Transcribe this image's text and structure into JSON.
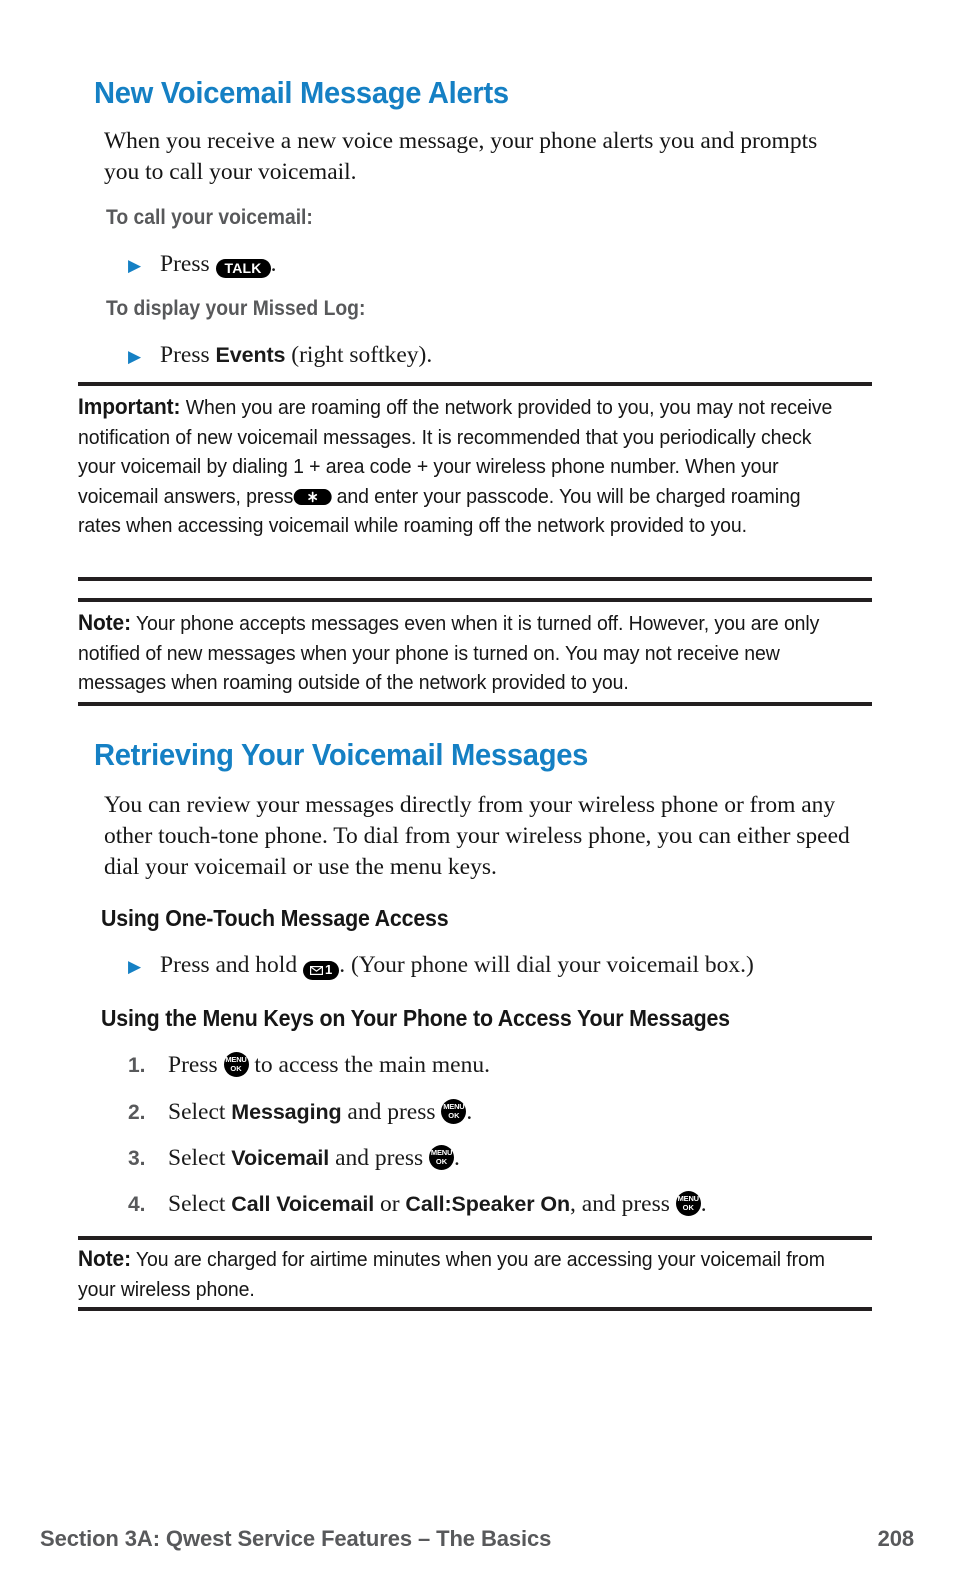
{
  "page": {
    "number": "208",
    "footer_section": "Section 3A: Qwest Service Features – The Basics",
    "accent_color": "#1580c4",
    "subheading_color": "#58595b",
    "body_color": "#151515"
  },
  "section1": {
    "heading": "New Voicemail Message Alerts",
    "intro": "When you receive a new voice message, your phone alerts you and prompts you to call your voicemail.",
    "sub1": "To call your voicemail:",
    "bullet1_pre": "Press",
    "bullet1_key": "TALK",
    "bullet1_post": ".",
    "sub2": "To display your Missed Log:",
    "bullet2_pre": "Press",
    "bullet2_bold": "Events",
    "bullet2_post": "(right softkey)."
  },
  "important": {
    "label": "Important:",
    "text_part1": "When you are roaming off the network provided to you, you may not receive notification of new voicemail messages. It is recommended that you periodically check your voicemail by dialing 1 + area code + your wireless phone number. When your voicemail answers, press",
    "key": "star-key",
    "text_part2": "and enter your passcode. You will be charged roaming rates when accessing voicemail while roaming off the network provided to you."
  },
  "note1": {
    "label": "Note:",
    "text": "Your phone accepts messages even when it is turned off. However, you are only notified of new messages when your phone is turned on. You may not receive new messages when roaming outside of the network provided to you."
  },
  "section2": {
    "heading": "Retrieving Your Voicemail Messages",
    "intro": "You can review your messages directly from your wireless phone or from any other touch-tone phone. To dial from your wireless phone, you can either speed dial your voicemail or use the menu keys.",
    "sub1": "Using One-Touch Message Access",
    "bullet1_pre": "Press and hold",
    "bullet1_key": "voicemail-key",
    "bullet1_key_label": "1",
    "bullet1_post": ". (Your phone will dial your voicemail box.)",
    "sub2": "Using the Menu Keys on Your Phone to Access Your Messages",
    "steps": [
      {
        "number": "1.",
        "pre": "Press",
        "key": "MENU/OK",
        "post": "to access the main menu.",
        "bold": "",
        "bold2": "",
        "mid": ""
      },
      {
        "number": "2.",
        "pre": "Select",
        "bold": "Messaging",
        "mid": "and press",
        "key": "MENU/OK",
        "post": ".",
        "bold2": ""
      },
      {
        "number": "3.",
        "pre": "Select",
        "bold": "Voicemail",
        "mid": "and press",
        "key": "MENU/OK",
        "post": ".",
        "bold2": ""
      },
      {
        "number": "4.",
        "pre": "Select",
        "bold": "Call Voicemail",
        "mid": "or",
        "bold2": "Call:Speaker On",
        "mid2": ", and press",
        "key": "MENU/OK",
        "post": "."
      }
    ]
  },
  "note2": {
    "label": "Note:",
    "text": "You are charged for airtime minutes when you are accessing your voicemail from your wireless phone."
  },
  "key_labels": {
    "menu_top": "MENU",
    "menu_bottom": "OK"
  }
}
